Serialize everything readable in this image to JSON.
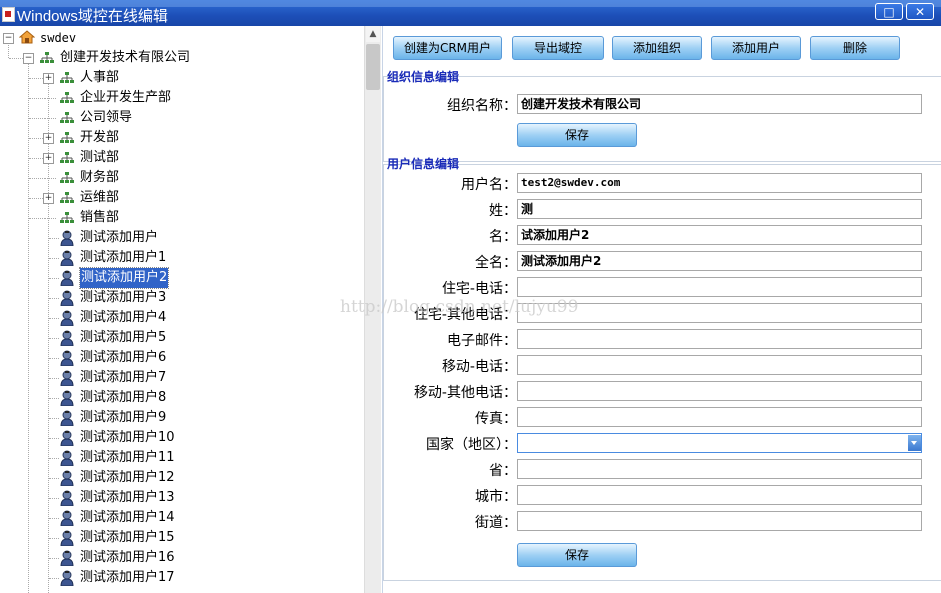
{
  "window": {
    "title": "Windows域控在线编辑"
  },
  "tree": {
    "root": "swdev",
    "company": "创建开发技术有限公司",
    "departments": [
      "人事部",
      "企业开发生产部",
      "公司领导",
      "开发部",
      "测试部",
      "财务部",
      "运维部",
      "销售部"
    ],
    "users": [
      "测试添加用户",
      "测试添加用户1",
      "测试添加用户2",
      "测试添加用户3",
      "测试添加用户4",
      "测试添加用户5",
      "测试添加用户6",
      "测试添加用户7",
      "测试添加用户8",
      "测试添加用户9",
      "测试添加用户10",
      "测试添加用户11",
      "测试添加用户12",
      "测试添加用户13",
      "测试添加用户14",
      "测试添加用户15",
      "测试添加用户16",
      "测试添加用户17"
    ],
    "selected_user": "测试添加用户2"
  },
  "toolbar": {
    "create_crm": "创建为CRM用户",
    "export": "导出域控",
    "add_org": "添加组织",
    "add_user": "添加用户",
    "delete": "删除"
  },
  "org_section": {
    "title": "组织信息编辑",
    "name_label": "组织名称：",
    "name_value": "创建开发技术有限公司",
    "save": "保存"
  },
  "user_section": {
    "title": "用户信息编辑",
    "fields": [
      {
        "label": "用户名：",
        "value": "test2@swdev.com"
      },
      {
        "label": "姓：",
        "value": "测"
      },
      {
        "label": "名：",
        "value": "试添加用户2"
      },
      {
        "label": "全名：",
        "value": "测试添加用户2"
      },
      {
        "label": "住宅-电话：",
        "value": ""
      },
      {
        "label": "住宅-其他电话：",
        "value": ""
      },
      {
        "label": "电子邮件：",
        "value": ""
      },
      {
        "label": "移动-电话：",
        "value": ""
      },
      {
        "label": "移动-其他电话：",
        "value": ""
      },
      {
        "label": "传真：",
        "value": ""
      },
      {
        "label": "国家（地区）：",
        "value": ""
      },
      {
        "label": "省：",
        "value": ""
      },
      {
        "label": "城市：",
        "value": ""
      },
      {
        "label": "街道：",
        "value": ""
      }
    ],
    "save": "保存"
  },
  "watermark": "http://blog.csdn.net/lujyu99",
  "colors": {
    "title_bar": "#1d4fb8",
    "section_title": "#1a2bb8",
    "selection": "#3164c8"
  }
}
